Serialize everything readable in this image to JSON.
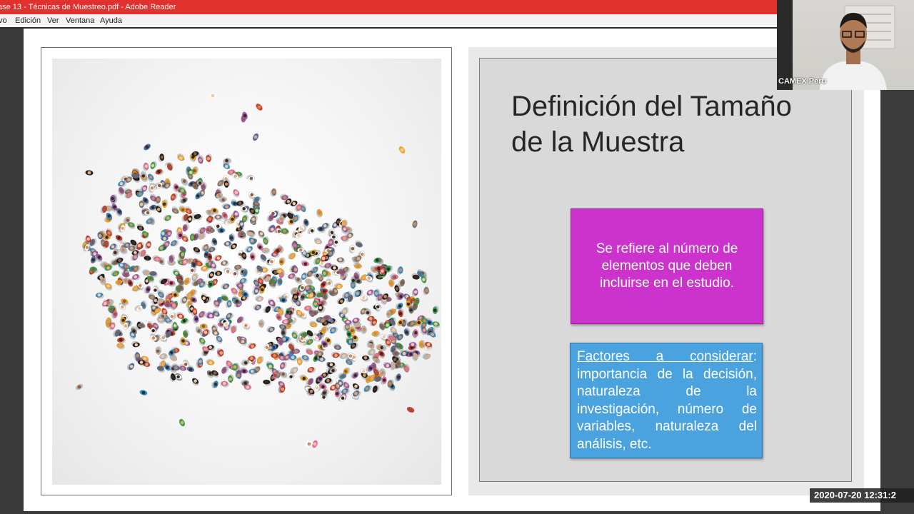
{
  "window": {
    "title": "ase 13 - Técnicas de Muestreo.pdf - Adobe Reader"
  },
  "menu": {
    "items": [
      "vo",
      "Edición",
      "Ver",
      "Ventana",
      "Ayuda"
    ]
  },
  "slide": {
    "title_line1": "Definición del Tamaño",
    "title_line2": "de la Muestra",
    "definition": "Se refiere al número de elementos que deben incluirse en el estudio.",
    "factors_heading": "Factores a considerar",
    "factors_colon": ":",
    "factors_body": " importancia de la decisión, naturaleza de la investigación, número de variables, naturaleza del análisis, etc."
  },
  "webcam": {
    "label": "CAMEX Peru"
  },
  "overlay": {
    "timestamp": "2020-07-20 12:31:2"
  },
  "colors": {
    "titlebar": "#e0312f",
    "magenta_box": "#cc33cc",
    "blue_box": "#4aa3de"
  }
}
